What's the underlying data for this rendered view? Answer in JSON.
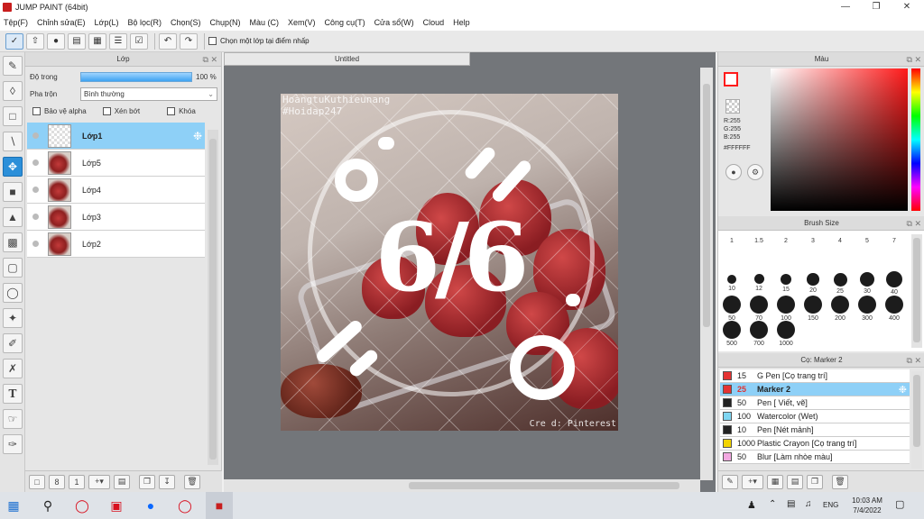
{
  "window": {
    "title": "JUMP PAINT (64bit)"
  },
  "menu": [
    "Tệp(F)",
    "Chỉnh sửa(E)",
    "Lớp(L)",
    "Bộ lọc(R)",
    "Chọn(S)",
    "Chụp(N)",
    "Màu (C)",
    "Xem(V)",
    "Công cụ(T)",
    "Cửa sổ(W)",
    "Cloud",
    "Help"
  ],
  "toolbar": {
    "pick_layer_label": "Chọn một lớp tại điểm nhấp"
  },
  "layer_panel": {
    "title": "Lớp",
    "opacity_label": "Độ trong",
    "opacity_value": "100 %",
    "opacity": 1.0,
    "blend_label": "Pha trộn",
    "blend_value": "Bình thường",
    "protect_alpha": "Bảo vệ alpha",
    "clipping": "Xén bớt",
    "lock": "Khóa",
    "layers": [
      {
        "name": "Lớp1",
        "selected": true
      },
      {
        "name": "Lớp5",
        "selected": false
      },
      {
        "name": "Lớp4",
        "selected": false
      },
      {
        "name": "Lớp3",
        "selected": false
      },
      {
        "name": "Lớp2",
        "selected": false
      }
    ]
  },
  "document": {
    "tab": "Untitled",
    "art": {
      "credit_top_1": "HoàngtuKuthieunang",
      "credit_top_2": "#Hoidap247",
      "center_text": "6/6",
      "credit_bottom": "Cre d: Pinterest"
    }
  },
  "color_panel": {
    "title": "Màu",
    "r": "R:255",
    "g": "G:255",
    "b": "B:255",
    "hex": "#FFFFFF",
    "primary_color": "#ff1a1a",
    "secondary_color": "#ffffff"
  },
  "brush_size_panel": {
    "title": "Brush Size",
    "sizes": [
      "1",
      "1.5",
      "2",
      "3",
      "4",
      "5",
      "7",
      "10",
      "12",
      "15",
      "20",
      "25",
      "30",
      "40",
      "50",
      "70",
      "100",
      "150",
      "200",
      "300",
      "400",
      "500",
      "700",
      "1000"
    ]
  },
  "brush_panel": {
    "title": "Cọ: Marker 2",
    "brushes": [
      {
        "size": "15",
        "name": "G Pen [Cọ trang trí]",
        "color": "#e53333",
        "selected": false
      },
      {
        "size": "25",
        "name": "Marker 2",
        "color": "#e53333",
        "selected": true
      },
      {
        "size": "50",
        "name": "Pen [ Viết, vẽ]",
        "color": "#222222",
        "selected": false
      },
      {
        "size": "100",
        "name": "Watercolor (Wet)",
        "color": "#7fd6f2",
        "selected": false
      },
      {
        "size": "10",
        "name": "Pen [Nét mảnh]",
        "color": "#222222",
        "selected": false
      },
      {
        "size": "1000",
        "name": "Plastic Crayon [Cọ trang trí]",
        "color": "#f2d400",
        "selected": false
      },
      {
        "size": "50",
        "name": "Blur [Làm nhòe màu]",
        "color": "#f2a8e0",
        "selected": false
      }
    ]
  },
  "taskbar": {
    "language": "ENG",
    "time": "10:03 AM",
    "date": "7/4/2022"
  }
}
